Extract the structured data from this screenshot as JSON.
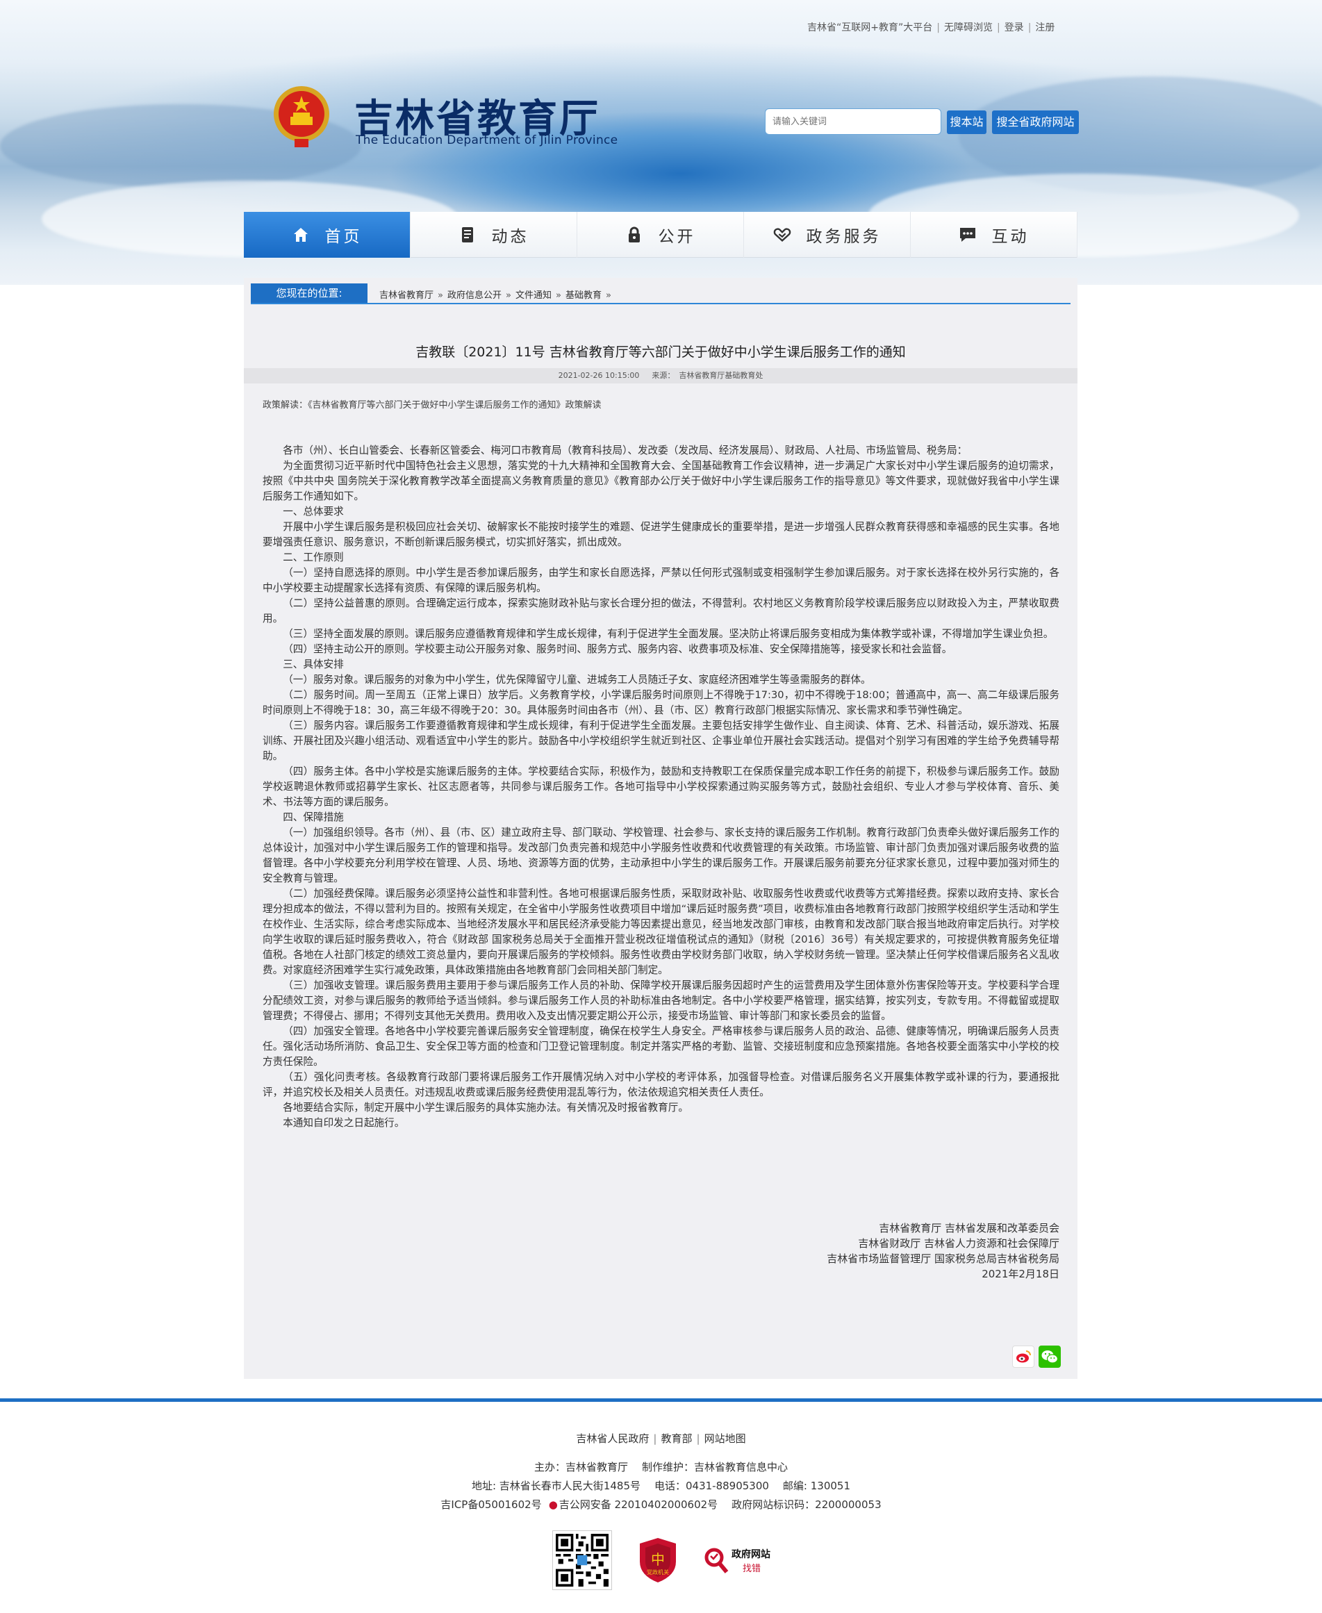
{
  "header": {
    "top_links": [
      "吉林省“互联网+教育”大平台",
      "无障碍浏览",
      "登录",
      "注册"
    ],
    "site_title": "吉林省教育厅",
    "site_subtitle": "The Education Department of Jilin Province",
    "search": {
      "placeholder": "请输入关键词",
      "btn_site": "搜本站",
      "btn_gov": "搜全省政府网站"
    }
  },
  "nav": {
    "items": [
      {
        "label": "首页",
        "icon": "home-icon",
        "active": true
      },
      {
        "label": "动态",
        "icon": "news-icon",
        "active": false
      },
      {
        "label": "公开",
        "icon": "lock-icon",
        "active": false
      },
      {
        "label": "政务服务",
        "icon": "handshake-icon",
        "active": false
      },
      {
        "label": "互动",
        "icon": "chat-icon",
        "active": false
      }
    ]
  },
  "breadcrumb": {
    "label": "您现在的位置:",
    "items": [
      "吉林省教育厅",
      "政府信息公开",
      "文件通知",
      "基础教育"
    ]
  },
  "article": {
    "title": "吉教联〔2021〕11号 吉林省教育厅等六部门关于做好中小学生课后服务工作的通知",
    "date": "2021-02-26 10:15:00",
    "source_label": "来源：",
    "source": "吉林省教育厅基础教育处",
    "policy_label": "政策解读：",
    "policy_link": "《吉林省教育厅等六部门关于做好中小学生课后服务工作的通知》政策解读",
    "paragraphs": [
      "各市（州）、长白山管委会、长春新区管委会、梅河口市教育局（教育科技局）、发改委（发改局、经济发展局）、财政局、人社局、市场监管局、税务局：",
      "为全面贯彻习近平新时代中国特色社会主义思想，落实党的十九大精神和全国教育大会、全国基础教育工作会议精神，进一步满足广大家长对中小学生课后服务的迫切需求，按照《中共中央 国务院关于深化教育教学改革全面提高义务教育质量的意见》《教育部办公厅关于做好中小学生课后服务工作的指导意见》等文件要求，现就做好我省中小学生课后服务工作通知如下。",
      "一、总体要求",
      "开展中小学生课后服务是积极回应社会关切、破解家长不能按时接学生的难题、促进学生健康成长的重要举措，是进一步增强人民群众教育获得感和幸福感的民生实事。各地要增强责任意识、服务意识，不断创新课后服务模式，切实抓好落实，抓出成效。",
      "二、工作原则",
      "（一）坚持自愿选择的原则。中小学生是否参加课后服务，由学生和家长自愿选择，严禁以任何形式强制或变相强制学生参加课后服务。对于家长选择在校外另行实施的，各中小学校要主动提醒家长选择有资质、有保障的课后服务机构。",
      "（二）坚持公益普惠的原则。合理确定运行成本，探索实施财政补贴与家长合理分担的做法，不得营利。农村地区义务教育阶段学校课后服务应以财政投入为主，严禁收取费用。",
      "（三）坚持全面发展的原则。课后服务应遵循教育规律和学生成长规律，有利于促进学生全面发展。坚决防止将课后服务变相成为集体教学或补课，不得增加学生课业负担。",
      "（四）坚持主动公开的原则。学校要主动公开服务对象、服务时间、服务方式、服务内容、收费事项及标准、安全保障措施等，接受家长和社会监督。",
      "三、具体安排",
      "（一）服务对象。课后服务的对象为中小学生，优先保障留守儿童、进城务工人员随迁子女、家庭经济困难学生等亟需服务的群体。",
      "（二）服务时间。周一至周五（正常上课日）放学后。义务教育学校，小学课后服务时间原则上不得晚于17:30，初中不得晚于18:00；普通高中，高一、高二年级课后服务时间原则上不得晚于18：30，高三年级不得晚于20：30。具体服务时间由各市（州）、县（市、区）教育行政部门根据实际情况、家长需求和季节弹性确定。",
      "（三）服务内容。课后服务工作要遵循教育规律和学生成长规律，有利于促进学生全面发展。主要包括安排学生做作业、自主阅读、体育、艺术、科普活动，娱乐游戏、拓展训练、开展社团及兴趣小组活动、观看适宜中小学生的影片。鼓励各中小学校组织学生就近到社区、企事业单位开展社会实践活动。提倡对个别学习有困难的学生给予免费辅导帮助。",
      "（四）服务主体。各中小学校是实施课后服务的主体。学校要结合实际，积极作为，鼓励和支持教职工在保质保量完成本职工作任务的前提下，积极参与课后服务工作。鼓励学校返聘退休教师或招募学生家长、社区志愿者等，共同参与课后服务工作。各地可指导中小学校探索通过购买服务等方式，鼓励社会组织、专业人才参与学校体育、音乐、美术、书法等方面的课后服务。",
      "四、保障措施",
      "（一）加强组织领导。各市（州）、县（市、区）建立政府主导、部门联动、学校管理、社会参与、家长支持的课后服务工作机制。教育行政部门负责牵头做好课后服务工作的总体设计，加强对中小学生课后服务工作的管理和指导。发改部门负责完善和规范中小学服务性收费和代收费管理的有关政策。市场监管、审计部门负责加强对课后服务收费的监督管理。各中小学校要充分利用学校在管理、人员、场地、资源等方面的优势，主动承担中小学生的课后服务工作。开展课后服务前要充分征求家长意见，过程中要加强对师生的安全教育与管理。",
      "（二）加强经费保障。课后服务必须坚持公益性和非营利性。各地可根据课后服务性质，采取财政补贴、收取服务性收费或代收费等方式筹措经费。探索以政府支持、家长合理分担成本的做法，不得以营利为目的。按照有关规定，在全省中小学服务性收费项目中增加“课后延时服务费”项目，收费标准由各地教育行政部门按照学校组织学生活动和学生在校作业、生活实际，综合考虑实际成本、当地经济发展水平和居民经济承受能力等因素提出意见，经当地发改部门审核，由教育和发改部门联合报当地政府审定后执行。对学校向学生收取的课后延时服务费收入，符合《财政部 国家税务总局关于全面推开营业税改征增值税试点的通知》（财税〔2016〕36号）有关规定要求的，可按提供教育服务免征增值税。各地在人社部门核定的绩效工资总量内，要向开展课后服务的学校倾斜。服务性收费由学校财务部门收取，纳入学校财务统一管理。坚决禁止任何学校借课后服务名义乱收费。对家庭经济困难学生实行减免政策，具体政策措施由各地教育部门会同相关部门制定。",
      "（三）加强收支管理。课后服务费用主要用于参与课后服务工作人员的补助、保障学校开展课后服务因超时产生的运营费用及学生团体意外伤害保险等开支。学校要科学合理分配绩效工资，对参与课后服务的教师给予适当倾斜。参与课后服务工作人员的补助标准由各地制定。各中小学校要严格管理，据实结算，按实列支，专款专用。不得截留或提取管理费；不得侵占、挪用；不得列支其他无关费用。费用收入及支出情况要定期公开公示，接受市场监管、审计等部门和家长委员会的监督。",
      "（四）加强安全管理。各地各中小学校要完善课后服务安全管理制度，确保在校学生人身安全。严格审核参与课后服务人员的政治、品德、健康等情况，明确课后服务人员责任。强化活动场所消防、食品卫生、安全保卫等方面的检查和门卫登记管理制度。制定并落实严格的考勤、监管、交接班制度和应急预案措施。各地各校要全面落实中小学校的校方责任保险。",
      "（五）强化问责考核。各级教育行政部门要将课后服务工作开展情况纳入对中小学校的考评体系，加强督导检查。对借课后服务名义开展集体教学或补课的行为，要通报批评，并追究校长及相关人员责任。对违规乱收费或课后服务经费使用混乱等行为，依法依规追究相关责任人责任。",
      "各地要结合实际，制定开展中小学生课后服务的具体实施办法。有关情况及时报省教育厅。",
      "本通知自印发之日起施行。"
    ],
    "signatures": [
      "吉林省教育厅 吉林省发展和改革委员会",
      "吉林省财政厅 吉林省人力资源和社会保障厅",
      "吉林省市场监督管理厅 国家税务总局吉林省税务局",
      "2021年2月18日"
    ]
  },
  "share": {
    "weibo": "weibo-icon",
    "wechat": "wechat-icon"
  },
  "footer": {
    "links": [
      "吉林省人民政府",
      "教育部",
      "网站地图"
    ],
    "host": "主办：吉林省教育厅",
    "maintainer": "制作维护：吉林省教育信息中心",
    "address": "地址: 吉林省长春市人民大街1485号",
    "phone": "电话：0431-88905300",
    "postcode": "邮编: 130051",
    "icp": "吉ICP备05001602号",
    "police": "吉公网安备 22010402000602号",
    "site_code": "政府网站标识码：2200000053",
    "badge_party": "党政机关",
    "badge_error_1": "政府网站",
    "badge_error_2": "找错"
  },
  "colors": {
    "primary": "#1e6fc4",
    "title": "#0a2c66",
    "content_bg": "#f0f0f3"
  }
}
